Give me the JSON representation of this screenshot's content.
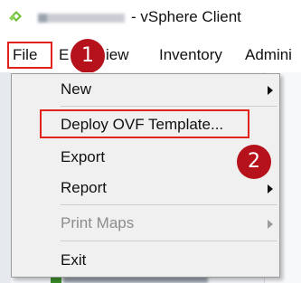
{
  "window": {
    "title": "- vSphere Client",
    "app_icon": "vsphere-icon",
    "hidden_host_label": ""
  },
  "menubar": {
    "items": [
      "File",
      "Edit",
      "View",
      "Inventory",
      "Administration"
    ],
    "visible_text": [
      "File",
      "E",
      "iew",
      "Inventory",
      "Admini"
    ]
  },
  "file_menu": {
    "items": [
      {
        "label": "New",
        "submenu": true,
        "enabled": true
      },
      {
        "label": "Deploy OVF Template...",
        "submenu": false,
        "enabled": true
      },
      {
        "label": "Export",
        "submenu": false,
        "enabled": true
      },
      {
        "label": "Report",
        "submenu": true,
        "enabled": true
      },
      {
        "label": "Print Maps",
        "submenu": true,
        "enabled": false
      },
      {
        "label": "Exit",
        "submenu": false,
        "enabled": true
      }
    ]
  },
  "annotations": {
    "step1": "1",
    "step2": "2",
    "highlight_color": "#e2231a",
    "badge_color": "#b5121b"
  }
}
